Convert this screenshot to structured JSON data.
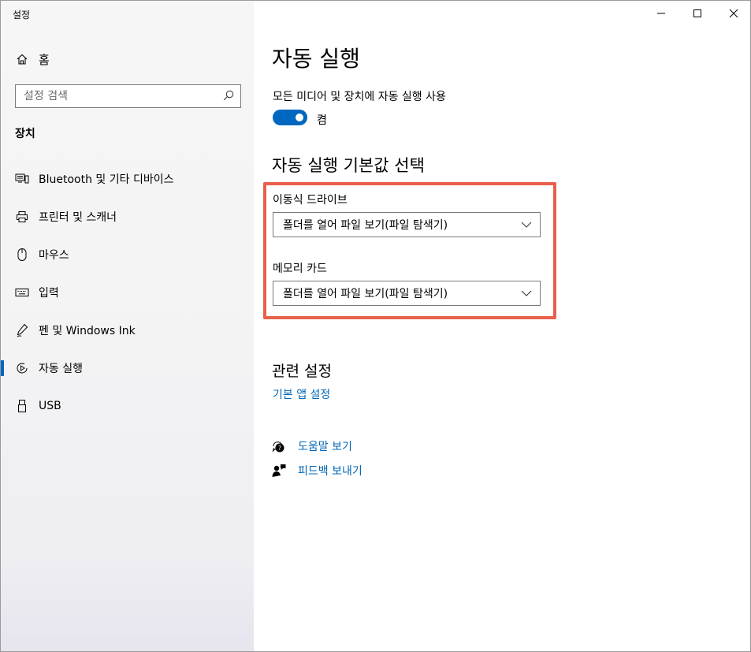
{
  "window": {
    "title": "설정"
  },
  "sidebar": {
    "home_label": "홈",
    "search_placeholder": "설정 검색",
    "section_title": "장치",
    "items": [
      {
        "label": "Bluetooth 및 기타 디바이스",
        "icon": "bluetooth-devices-icon"
      },
      {
        "label": "프린터 및 스캐너",
        "icon": "printer-icon"
      },
      {
        "label": "마우스",
        "icon": "mouse-icon"
      },
      {
        "label": "입력",
        "icon": "keyboard-icon"
      },
      {
        "label": "펜 및 Windows Ink",
        "icon": "pen-icon"
      },
      {
        "label": "자동 실행",
        "icon": "autoplay-icon",
        "selected": true
      },
      {
        "label": "USB",
        "icon": "usb-icon"
      }
    ]
  },
  "main": {
    "title": "자동 실행",
    "toggle_label": "모든 미디어 및 장치에 자동 실행 사용",
    "toggle_state": "켬",
    "toggle_on": true,
    "defaults_heading": "자동 실행 기본값 선택",
    "removable_drive": {
      "label": "이동식 드라이브",
      "value": "폴더를 열어 파일 보기(파일 탐색기)"
    },
    "memory_card": {
      "label": "메모리 카드",
      "value": "폴더를 열어 파일 보기(파일 탐색기)"
    },
    "related_heading": "관련 설정",
    "related_link": "기본 앱 설정",
    "help_link": "도움말 보기",
    "feedback_link": "피드백 보내기"
  },
  "colors": {
    "accent": "#0067c0",
    "highlight": "#e8604c",
    "link": "#0067b8"
  }
}
